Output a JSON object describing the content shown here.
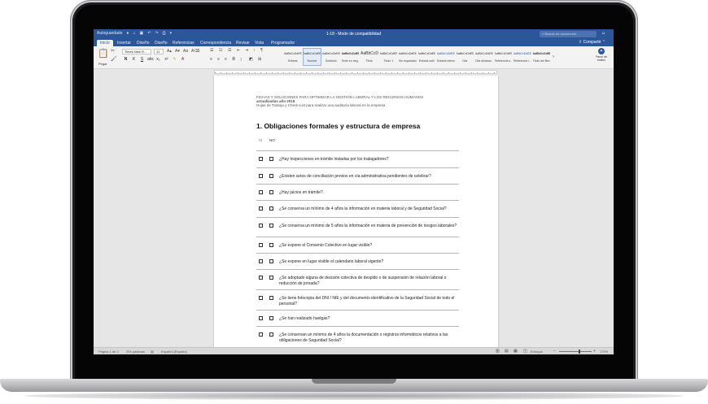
{
  "titlebar": {
    "autosave": "Autoguardado",
    "title": "1-18  -  Modo de compatibilidad",
    "search_placeholder": "Buscar en documento",
    "doc_icon": "word-document-icon"
  },
  "tabs": [
    "Inicio",
    "Insertar",
    "Diseño",
    "Diseño",
    "Referencias",
    "Correspondencia",
    "Revisar",
    "Vista",
    "Programador"
  ],
  "share_label": "Compartir",
  "ribbon": {
    "paste_label": "Pegar",
    "font_name": "Times New R...",
    "font_size": "12",
    "styles": [
      {
        "sample": "AaBbCcDdEE",
        "name": "Énfasis"
      },
      {
        "sample": "AaBbCcDdEE",
        "name": "Normal"
      },
      {
        "sample": "AaBbCcDdEE",
        "name": "Subtítulo"
      },
      {
        "sample": "AaBbCcDdEE",
        "name": "Texto en neg..."
      },
      {
        "sample": "AaBbCcDc",
        "name": "Título"
      },
      {
        "sample": "AaBbCcDdEE",
        "name": "Título 1"
      },
      {
        "sample": "AaBbCcDdEE",
        "name": "Sin espaciado"
      },
      {
        "sample": "AaBbCcDdEE",
        "name": "Énfasis sutil"
      },
      {
        "sample": "AaBbCcDdEE",
        "name": "Énfasis intenso"
      },
      {
        "sample": "AaBbCcDdEE",
        "name": "Cita"
      },
      {
        "sample": "AaBbCcDdEE",
        "name": "Cita destaca..."
      },
      {
        "sample": "AaBbCcDdEE",
        "name": "Referencia s..."
      },
      {
        "sample": "AaBbCcDdEE",
        "name": "Referencia i..."
      },
      {
        "sample": "AaBbCcDdEE",
        "name": "Título del libro"
      }
    ],
    "styles_pane_label": "Panel de estilos"
  },
  "document": {
    "header_line1": "FICHAS Y SOLUCIONES PARA OPTIMIZAR LA GESTIÓN LABORAL Y LOS RECURSOS HUMANOS",
    "header_line2": "actualizadas año 2018",
    "header_line3": "Hojas de Trabajo y Check-List para realizar una auditoría laboral en la empresa",
    "section_title": "1.  Obligaciones formales y estructura de empresa",
    "col_si": "SÍ",
    "col_no": "NO",
    "questions": [
      "¿Hay Inspecciones en trámite instadas por los trabajadores?",
      "¿Existen actos de conciliación previos en vía administrativa pendientes de celebrar?",
      "¿Hay juicios en trámite?",
      "¿Se conserva un mínimo de 4 años la información en materia laboral y de Seguridad Social?",
      "¿Se conserva un mínimo de 5 años la información en materia de prevención de riesgos laborales?",
      "¿Se expone el Convenio Colectivo en lugar visible?",
      "¿Se expone en lugar visible el calendario laboral vigente?",
      "¿Se adoptado alguna de decisión colectiva de despido o de suspensión de relación laboral o reducción de jornada?",
      "¿Se tiene fotocopia del DNI / NIE y del documento identificativo de la Seguridad Social de todo el personal?",
      "¿Se han realizado huelgas?",
      "¿Se conservan un mínimo de 4 años la documentación o registros informáticos relativos a las obligaciones de Seguridad Social?"
    ]
  },
  "statusbar": {
    "page": "Página 1 de 2",
    "words": "294 palabras",
    "language": "Español (España)",
    "focus": "Enfoque",
    "zoom": "170%"
  }
}
